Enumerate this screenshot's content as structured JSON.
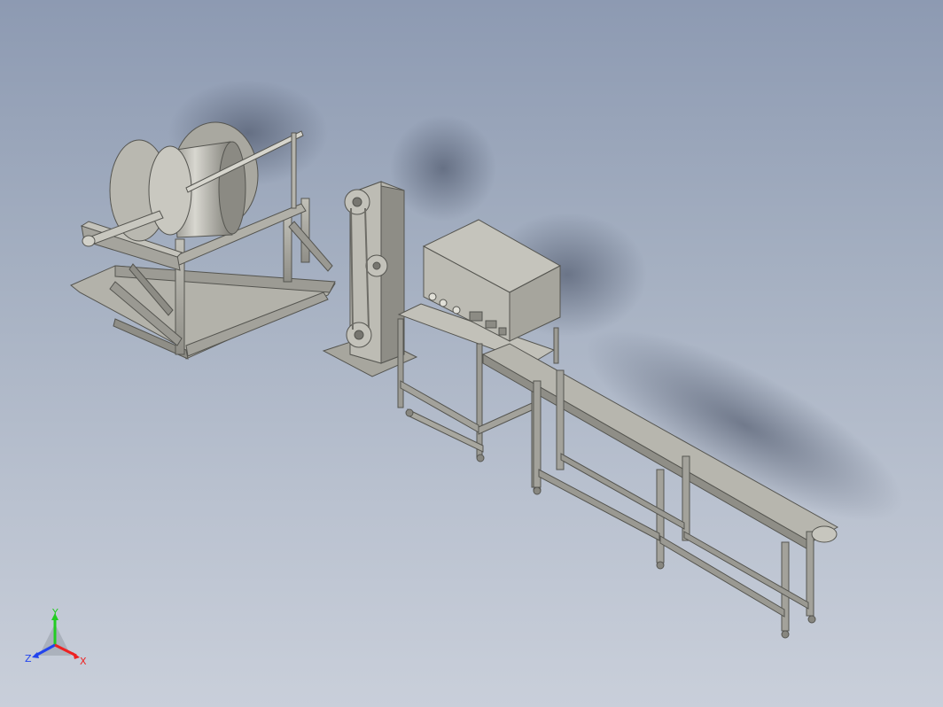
{
  "viewport": {
    "background_top": "#8d9ab2",
    "background_bottom": "#c9cfda"
  },
  "model": {
    "parts": [
      "cable-reel-stand",
      "pulley-tower",
      "control-cabinet-table",
      "belt-conveyor"
    ],
    "color": "#a9a89f"
  },
  "triad": {
    "y_label": "Y",
    "z_label": "Z",
    "x_label": "X",
    "y_color": "#22cc22",
    "z_color": "#2244ee",
    "x_color": "#ee2222"
  }
}
